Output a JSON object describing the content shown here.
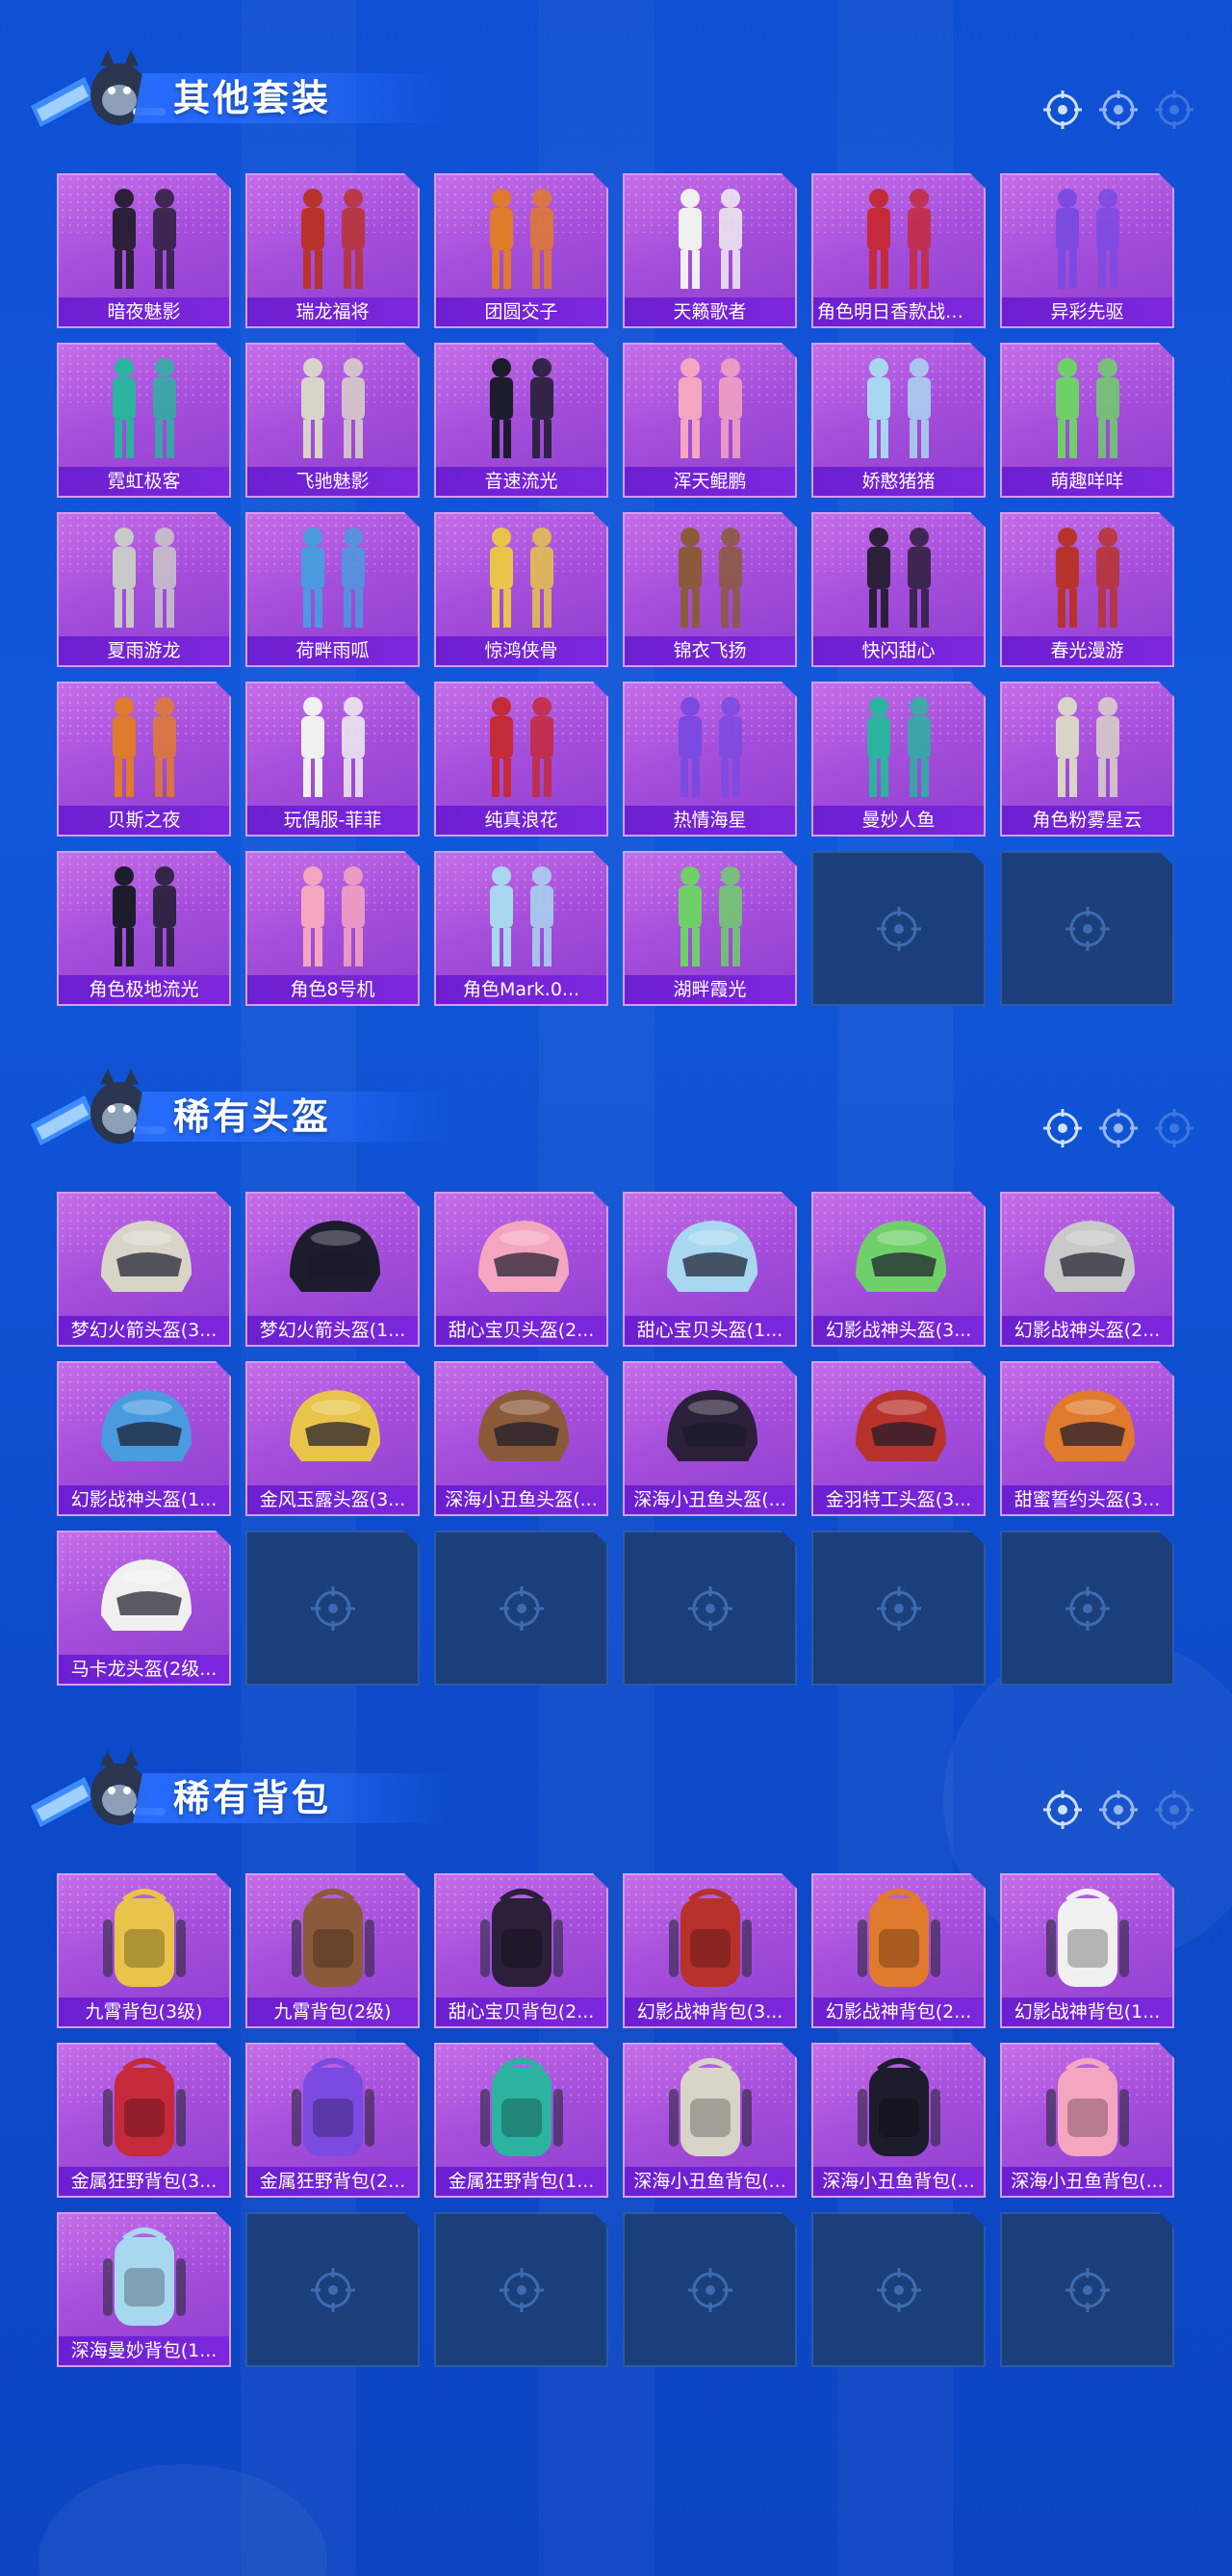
{
  "colors": {
    "background": "#1158da",
    "card_purple": "#a64fdc",
    "label_bar": "#6b1fd0",
    "empty_slot": "#1b3f7a"
  },
  "sections": [
    {
      "title": "其他套装",
      "icon": "mascot-icon",
      "items": [
        "暗夜魅影",
        "瑞龙福将",
        "团圆交子",
        "天籁歌者",
        "角色明日香款战斗...",
        "异彩先驱",
        "霓虹极客",
        "飞驰魅影",
        "音速流光",
        "浑天鲲鹏",
        "娇憨猪猪",
        "萌趣咩咩",
        "夏雨游龙",
        "荷畔雨呱",
        "惊鸿侠骨",
        "锦衣飞扬",
        "快闪甜心",
        "春光漫游",
        "贝斯之夜",
        "玩偶服-菲菲",
        "纯真浪花",
        "热情海星",
        "曼妙人鱼",
        "角色粉雾星云",
        "角色极地流光",
        "角色8号机",
        "角色Mark.0...",
        "湖畔霞光"
      ],
      "empty_slots": 2
    },
    {
      "title": "稀有头盔",
      "icon": "mascot-icon",
      "items": [
        "梦幻火箭头盔(3...",
        "梦幻火箭头盔(1...",
        "甜心宝贝头盔(2...",
        "甜心宝贝头盔(1...",
        "幻影战神头盔(3...",
        "幻影战神头盔(2...",
        "幻影战神头盔(1...",
        "金风玉露头盔(3...",
        "深海小丑鱼头盔(...",
        "深海小丑鱼头盔(...",
        "金羽特工头盔(3...",
        "甜蜜誓约头盔(3...",
        "马卡龙头盔(2级..."
      ],
      "empty_slots": 5
    },
    {
      "title": "稀有背包",
      "icon": "mascot-icon",
      "items": [
        "九霄背包(3级)",
        "九霄背包(2级)",
        "甜心宝贝背包(2...",
        "幻影战神背包(3...",
        "幻影战神背包(2...",
        "幻影战神背包(1...",
        "金属狂野背包(3...",
        "金属狂野背包(2...",
        "金属狂野背包(1...",
        "深海小丑鱼背包(...",
        "深海小丑鱼背包(...",
        "深海小丑鱼背包(...",
        "深海曼妙背包(1..."
      ],
      "empty_slots": 5
    }
  ]
}
